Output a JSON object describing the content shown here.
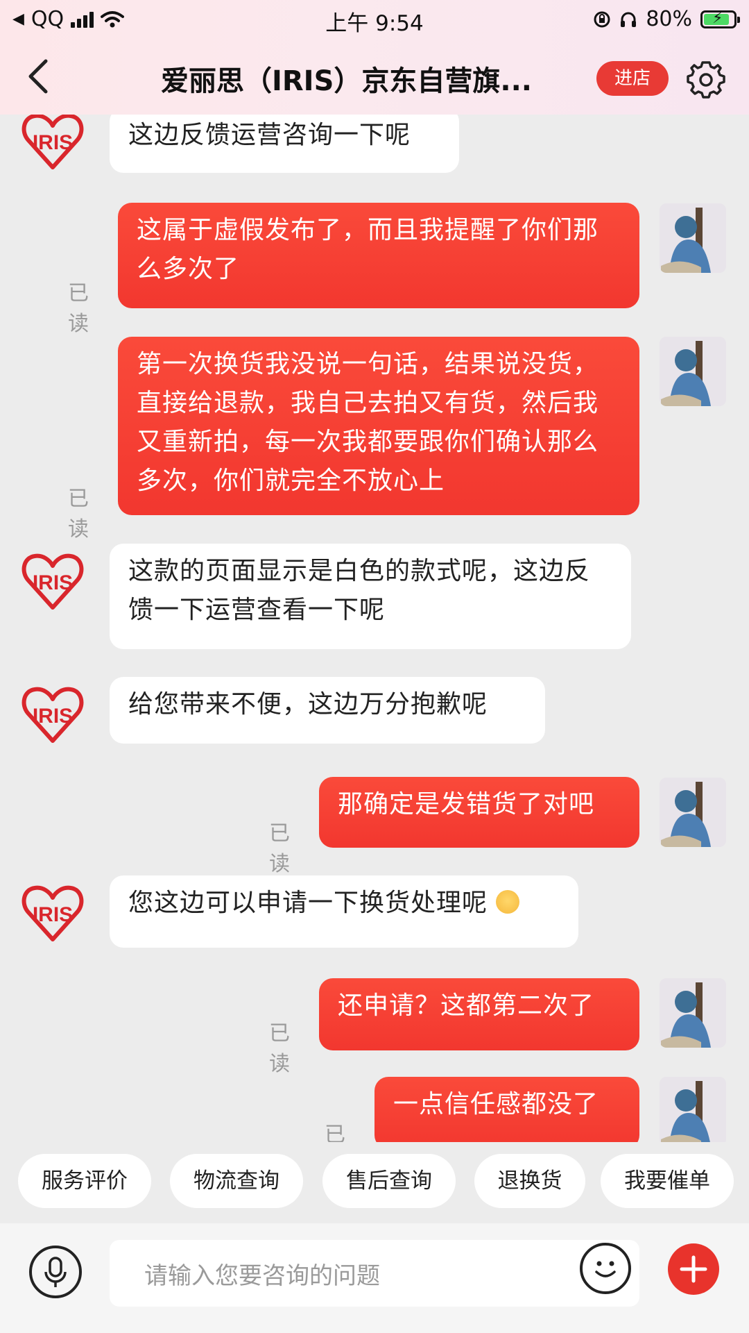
{
  "status_bar": {
    "back_app": "QQ",
    "time": "上午 9:54",
    "battery": "80%",
    "battery_level": 0.8
  },
  "header": {
    "title": "爱丽思（IRIS）京东自营旗...",
    "enter_shop": "进店",
    "icons": [
      "back-arrow-icon",
      "gear-icon"
    ]
  },
  "chat": {
    "read_label": "已读",
    "messages": [
      {
        "from": "shop",
        "text": "这边反馈运营咨询一下呢"
      },
      {
        "from": "user",
        "text": "这属于虚假发布了，而且我提醒了你们那么多次了",
        "status": "已读"
      },
      {
        "from": "user",
        "text": "第一次换货我没说一句话，结果说没货，直接给退款，我自己去拍又有货，然后我又重新拍，每一次我都要跟你们确认那么多次，你们就完全不放心上",
        "status": "已读"
      },
      {
        "from": "shop",
        "text": "这款的页面显示是白色的款式呢，这边反馈一下运营查看一下呢"
      },
      {
        "from": "shop",
        "text": "给您带来不便，这边万分抱歉呢"
      },
      {
        "from": "user",
        "text": "那确定是发错货了对吧",
        "status": "已读"
      },
      {
        "from": "shop",
        "text": "您这边可以申请一下换货处理呢",
        "emoji": "sleepy-face-emoji"
      },
      {
        "from": "user",
        "text": "还申请？这都第二次了",
        "status": "已读"
      },
      {
        "from": "user",
        "text": "一点信任感都没了",
        "status": "已读"
      }
    ],
    "shop_logo_text": "IRIS"
  },
  "quick_actions": [
    "服务评价",
    "物流查询",
    "售后查询",
    "退换货",
    "我要催单"
  ],
  "input": {
    "placeholder": "请输入您要咨询的问题",
    "icons": [
      "microphone-icon",
      "emoji-icon",
      "plus-icon"
    ]
  },
  "colors": {
    "accent": "#e83a35",
    "user_bubble": "#f5392f",
    "shop_bubble": "#ffffff",
    "background": "#ececec"
  }
}
